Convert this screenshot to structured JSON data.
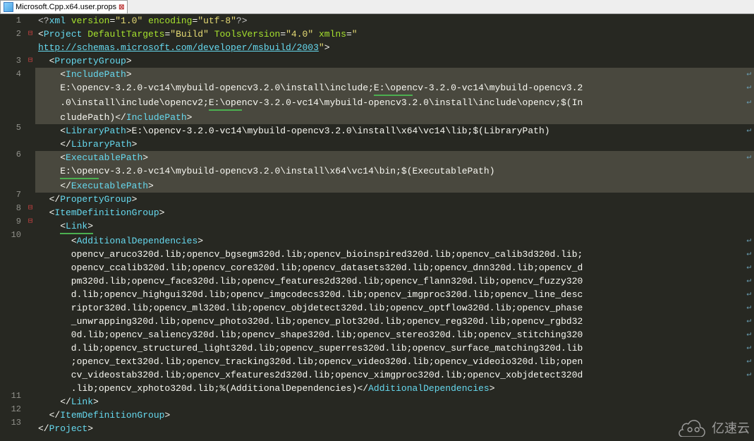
{
  "tab": {
    "title": "Microsoft.Cpp.x64.user.props"
  },
  "watermark": "亿速云",
  "lines": [
    {
      "n": "1",
      "fold": "",
      "hl": false,
      "segs": [
        {
          "c": "xml-decl",
          "t": "<?"
        },
        {
          "c": "tag-name",
          "t": "xml"
        },
        {
          "c": "text",
          "t": " "
        },
        {
          "c": "attr-name",
          "t": "version"
        },
        {
          "c": "tag-br",
          "t": "="
        },
        {
          "c": "attr-val",
          "t": "\"1.0\""
        },
        {
          "c": "text",
          "t": " "
        },
        {
          "c": "attr-name",
          "t": "encoding"
        },
        {
          "c": "tag-br",
          "t": "="
        },
        {
          "c": "attr-val",
          "t": "\"utf-8\""
        },
        {
          "c": "xml-decl",
          "t": "?>"
        }
      ]
    },
    {
      "n": "2",
      "fold": "⊟",
      "hl": false,
      "segs": [
        {
          "c": "tag-br",
          "t": "<"
        },
        {
          "c": "tag-name",
          "t": "Project"
        },
        {
          "c": "text",
          "t": " "
        },
        {
          "c": "attr-name",
          "t": "DefaultTargets"
        },
        {
          "c": "tag-br",
          "t": "="
        },
        {
          "c": "attr-val",
          "t": "\"Build\""
        },
        {
          "c": "text",
          "t": " "
        },
        {
          "c": "attr-name",
          "t": "ToolsVersion"
        },
        {
          "c": "tag-br",
          "t": "="
        },
        {
          "c": "attr-val",
          "t": "\"4.0\""
        },
        {
          "c": "text",
          "t": " "
        },
        {
          "c": "attr-name",
          "t": "xmlns"
        },
        {
          "c": "tag-br",
          "t": "="
        },
        {
          "c": "attr-val",
          "t": "\""
        }
      ]
    },
    {
      "n": "",
      "fold": "",
      "hl": false,
      "segs": [
        {
          "c": "link",
          "t": "http://schemas.microsoft.com/developer/msbuild/2003"
        },
        {
          "c": "attr-val",
          "t": "\""
        },
        {
          "c": "tag-br",
          "t": ">"
        }
      ]
    },
    {
      "n": "3",
      "fold": "⊟",
      "hl": false,
      "segs": [
        {
          "c": "text",
          "t": "  "
        },
        {
          "c": "tag-br",
          "t": "<"
        },
        {
          "c": "tag-name",
          "t": "PropertyGroup"
        },
        {
          "c": "tag-br",
          "t": ">"
        }
      ]
    },
    {
      "n": "4",
      "fold": "",
      "hl": true,
      "wrap": true,
      "segs": [
        {
          "c": "text",
          "t": "    "
        },
        {
          "c": "tag-br",
          "t": "<"
        },
        {
          "c": "tag-name",
          "t": "IncludePath"
        },
        {
          "c": "tag-br",
          "t": ">"
        }
      ]
    },
    {
      "n": "",
      "fold": "",
      "hl": true,
      "wrap": true,
      "ul": true,
      "segs": [
        {
          "c": "text",
          "t": "    E:\\opencv-3.2.0-vc14\\mybuild-opencv3.2.0\\install\\include;"
        },
        {
          "c": "text ul",
          "t": "E:\\open"
        },
        {
          "c": "text",
          "t": "cv-3.2.0-vc14\\mybuild-opencv3.2"
        }
      ]
    },
    {
      "n": "",
      "fold": "",
      "hl": true,
      "wrap": true,
      "segs": [
        {
          "c": "text",
          "t": "    .0\\install\\include\\opencv2;"
        },
        {
          "c": "text ul",
          "t": "E:\\ope"
        },
        {
          "c": "text",
          "t": "ncv-3.2.0-vc14\\mybuild-opencv3.2.0\\install\\include\\opencv;$(In"
        }
      ]
    },
    {
      "n": "",
      "fold": "",
      "hl": true,
      "segs": [
        {
          "c": "text",
          "t": "    cludePath)"
        },
        {
          "c": "tag-br",
          "t": "</"
        },
        {
          "c": "tag-name",
          "t": "IncludePath"
        },
        {
          "c": "tag-br",
          "t": ">"
        }
      ]
    },
    {
      "n": "5",
      "fold": "",
      "hl": false,
      "wrap": true,
      "segs": [
        {
          "c": "text",
          "t": "    "
        },
        {
          "c": "tag-br",
          "t": "<"
        },
        {
          "c": "tag-name",
          "t": "LibraryPath"
        },
        {
          "c": "tag-br",
          "t": ">"
        },
        {
          "c": "text",
          "t": "E:\\opencv-3.2.0-vc14\\mybuild-opencv3.2.0\\install\\x64\\vc14\\lib;$(LibraryPath)"
        }
      ]
    },
    {
      "n": "",
      "fold": "",
      "hl": false,
      "segs": [
        {
          "c": "text",
          "t": "    "
        },
        {
          "c": "tag-br",
          "t": "</"
        },
        {
          "c": "tag-name",
          "t": "LibraryPath"
        },
        {
          "c": "tag-br",
          "t": ">"
        }
      ]
    },
    {
      "n": "6",
      "fold": "",
      "hl": true,
      "wrap": true,
      "segs": [
        {
          "c": "text",
          "t": "    "
        },
        {
          "c": "tag-br",
          "t": "<"
        },
        {
          "c": "tag-name",
          "t": "ExecutablePath"
        },
        {
          "c": "tag-br",
          "t": ">"
        }
      ]
    },
    {
      "n": "",
      "fold": "",
      "hl": true,
      "ul2": true,
      "segs": [
        {
          "c": "text",
          "t": "    "
        },
        {
          "c": "text ul",
          "t": "E:\\open"
        },
        {
          "c": "text",
          "t": "cv-3.2.0-vc14\\mybuild-opencv3.2.0\\install\\x64\\vc14\\bin;$(ExecutablePath)"
        }
      ]
    },
    {
      "n": "",
      "fold": "",
      "hl": true,
      "segs": [
        {
          "c": "text",
          "t": "    "
        },
        {
          "c": "tag-br",
          "t": "</"
        },
        {
          "c": "tag-name",
          "t": "ExecutablePath"
        },
        {
          "c": "tag-br",
          "t": ">"
        }
      ]
    },
    {
      "n": "7",
      "fold": "",
      "hl": false,
      "segs": [
        {
          "c": "text",
          "t": "  "
        },
        {
          "c": "tag-br",
          "t": "</"
        },
        {
          "c": "tag-name",
          "t": "PropertyGroup"
        },
        {
          "c": "tag-br",
          "t": ">"
        }
      ]
    },
    {
      "n": "8",
      "fold": "⊟",
      "hl": false,
      "segs": [
        {
          "c": "text",
          "t": "  "
        },
        {
          "c": "tag-br",
          "t": "<"
        },
        {
          "c": "tag-name",
          "t": "ItemDefinitionGroup"
        },
        {
          "c": "tag-br",
          "t": ">"
        }
      ]
    },
    {
      "n": "9",
      "fold": "⊟",
      "hl": false,
      "ul3": true,
      "segs": [
        {
          "c": "text",
          "t": "    "
        },
        {
          "c": "tag-br ul",
          "t": "<"
        },
        {
          "c": "tag-name ul",
          "t": "Link"
        },
        {
          "c": "tag-br ul",
          "t": ">"
        }
      ]
    },
    {
      "n": "10",
      "fold": "",
      "hl": false,
      "wrap": true,
      "segs": [
        {
          "c": "text",
          "t": "      "
        },
        {
          "c": "tag-br",
          "t": "<"
        },
        {
          "c": "tag-name",
          "t": "AdditionalDependencies"
        },
        {
          "c": "tag-br",
          "t": ">"
        }
      ]
    },
    {
      "n": "",
      "fold": "",
      "hl": false,
      "wrap": true,
      "segs": [
        {
          "c": "text",
          "t": "      opencv_aruco320d.lib;opencv_bgsegm320d.lib;opencv_bioinspired320d.lib;opencv_calib3d320d.lib;"
        }
      ]
    },
    {
      "n": "",
      "fold": "",
      "hl": false,
      "wrap": true,
      "segs": [
        {
          "c": "text",
          "t": "      opencv_ccalib320d.lib;opencv_core320d.lib;opencv_datasets320d.lib;opencv_dnn320d.lib;opencv_d"
        }
      ]
    },
    {
      "n": "",
      "fold": "",
      "hl": false,
      "wrap": true,
      "segs": [
        {
          "c": "text",
          "t": "      pm320d.lib;opencv_face320d.lib;opencv_features2d320d.lib;opencv_flann320d.lib;opencv_fuzzy320"
        }
      ]
    },
    {
      "n": "",
      "fold": "",
      "hl": false,
      "wrap": true,
      "segs": [
        {
          "c": "text",
          "t": "      d.lib;opencv_highgui320d.lib;opencv_imgcodecs320d.lib;opencv_imgproc320d.lib;opencv_line_desc"
        }
      ]
    },
    {
      "n": "",
      "fold": "",
      "hl": false,
      "wrap": true,
      "segs": [
        {
          "c": "text",
          "t": "      riptor320d.lib;opencv_ml320d.lib;opencv_objdetect320d.lib;opencv_optflow320d.lib;opencv_phase"
        }
      ]
    },
    {
      "n": "",
      "fold": "",
      "hl": false,
      "wrap": true,
      "segs": [
        {
          "c": "text",
          "t": "      _unwrapping320d.lib;opencv_photo320d.lib;opencv_plot320d.lib;opencv_reg320d.lib;opencv_rgbd32"
        }
      ]
    },
    {
      "n": "",
      "fold": "",
      "hl": false,
      "wrap": true,
      "segs": [
        {
          "c": "text",
          "t": "      0d.lib;opencv_saliency320d.lib;opencv_shape320d.lib;opencv_stereo320d.lib;opencv_stitching320"
        }
      ]
    },
    {
      "n": "",
      "fold": "",
      "hl": false,
      "wrap": true,
      "segs": [
        {
          "c": "text",
          "t": "      d.lib;opencv_structured_light320d.lib;opencv_superres320d.lib;opencv_surface_matching320d.lib"
        }
      ]
    },
    {
      "n": "",
      "fold": "",
      "hl": false,
      "wrap": true,
      "segs": [
        {
          "c": "text",
          "t": "      ;opencv_text320d.lib;opencv_tracking320d.lib;opencv_video320d.lib;opencv_videoio320d.lib;open"
        }
      ]
    },
    {
      "n": "",
      "fold": "",
      "hl": false,
      "wrap": true,
      "segs": [
        {
          "c": "text",
          "t": "      cv_videostab320d.lib;opencv_xfeatures2d320d.lib;opencv_ximgproc320d.lib;opencv_xobjdetect320d"
        }
      ]
    },
    {
      "n": "",
      "fold": "",
      "hl": false,
      "segs": [
        {
          "c": "text",
          "t": "      .lib;opencv_xphoto320d.lib;%(AdditionalDependencies)"
        },
        {
          "c": "tag-br",
          "t": "</"
        },
        {
          "c": "tag-name",
          "t": "AdditionalDependencies"
        },
        {
          "c": "tag-br",
          "t": ">"
        }
      ]
    },
    {
      "n": "11",
      "fold": "",
      "hl": false,
      "segs": [
        {
          "c": "text",
          "t": "    "
        },
        {
          "c": "tag-br",
          "t": "</"
        },
        {
          "c": "tag-name",
          "t": "Link"
        },
        {
          "c": "tag-br",
          "t": ">"
        }
      ]
    },
    {
      "n": "12",
      "fold": "",
      "hl": false,
      "segs": [
        {
          "c": "text",
          "t": "  "
        },
        {
          "c": "tag-br",
          "t": "</"
        },
        {
          "c": "tag-name",
          "t": "ItemDefinitionGroup"
        },
        {
          "c": "tag-br",
          "t": ">"
        }
      ]
    },
    {
      "n": "13",
      "fold": "",
      "hl": false,
      "segs": [
        {
          "c": "tag-br",
          "t": "</"
        },
        {
          "c": "tag-name",
          "t": "Project"
        },
        {
          "c": "tag-br",
          "t": ">"
        }
      ]
    }
  ]
}
